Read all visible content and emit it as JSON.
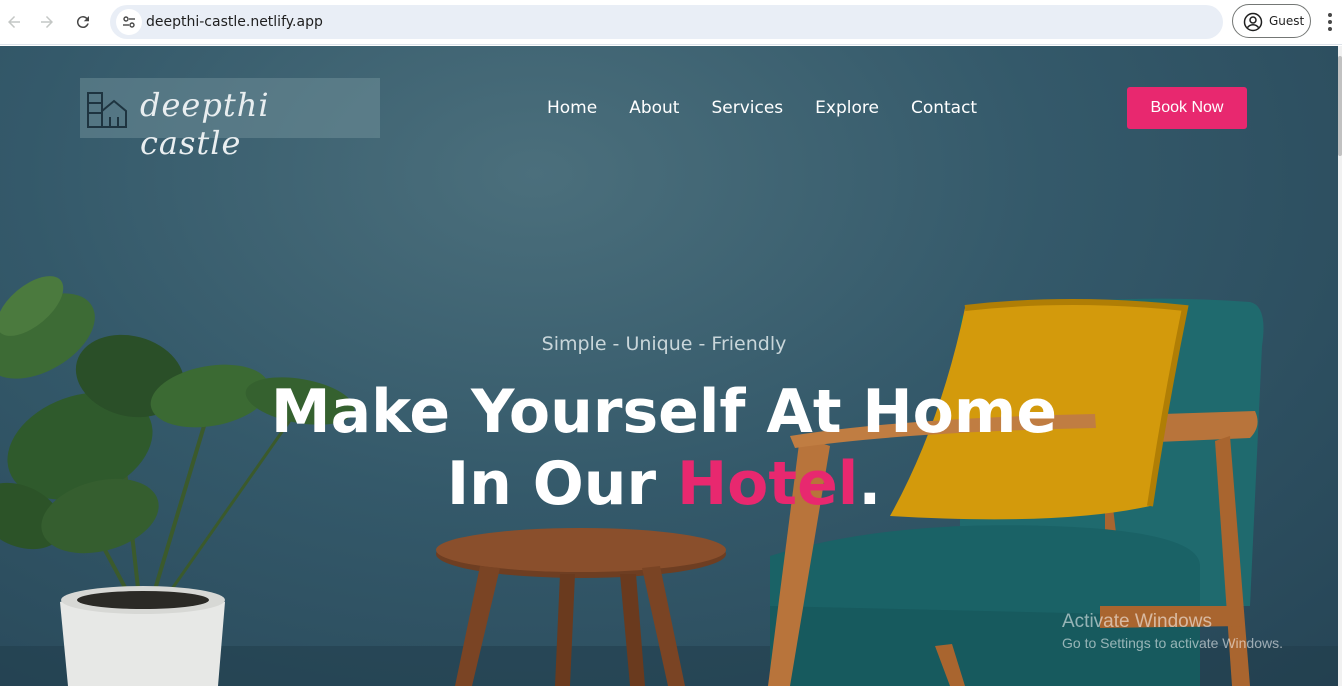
{
  "browser": {
    "url": "deepthi-castle.netlify.app",
    "profile_label": "Guest"
  },
  "header": {
    "logo_text": "deepthi castle",
    "nav": [
      "Home",
      "About",
      "Services",
      "Explore",
      "Contact"
    ],
    "cta": "Book Now"
  },
  "hero": {
    "tagline": "Simple - Unique - Friendly",
    "line1": "Make Yourself At Home",
    "line2_prefix": "In Our ",
    "line2_accent": "Hotel",
    "line2_suffix": "."
  },
  "watermark": {
    "title": "Activate Windows",
    "subtitle": "Go to Settings to activate Windows."
  },
  "colors": {
    "accent": "#e8286f",
    "wall": "#34596a",
    "cushion": "#d39a0c",
    "chair_fabric": "#1f6a6e",
    "wood": "#b8743b"
  }
}
